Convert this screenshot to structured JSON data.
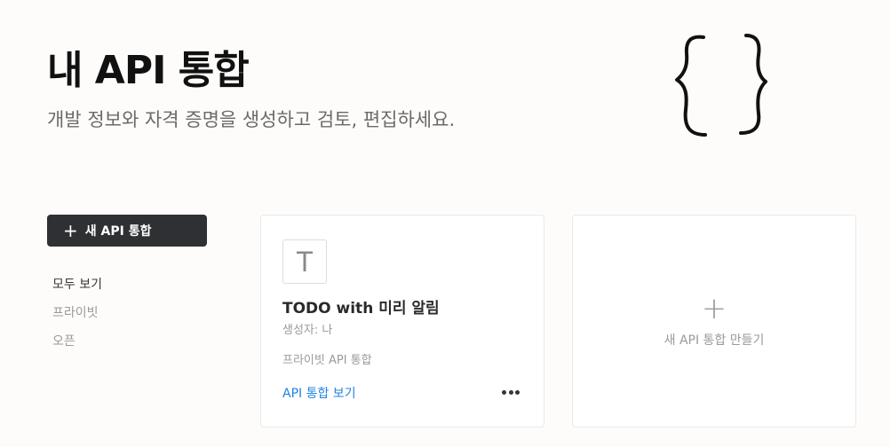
{
  "header": {
    "title": "내 API 통합",
    "subtitle": "개발 정보와 자격 증명을 생성하고 검토, 편집하세요.",
    "illustration_icon": "curly-braces-icon"
  },
  "sidebar": {
    "new_button": {
      "icon": "plus-icon",
      "label": "새 API 통합"
    },
    "filters": [
      {
        "label": "모두 보기",
        "active": true
      },
      {
        "label": "프라이빗",
        "active": false
      },
      {
        "label": "오픈",
        "active": false
      }
    ]
  },
  "integrations": [
    {
      "avatar_letter": "T",
      "name": "TODO with 미리 알림",
      "creator": "생성자: 나",
      "type": "프라이빗 API 통합",
      "view_label": "API 통합 보기",
      "more_icon": "more-horizontal-icon"
    }
  ],
  "create_card": {
    "icon": "plus-icon",
    "label": "새 API 통합 만들기"
  },
  "colors": {
    "background": "#fdfcfa",
    "button_dark": "#2f3033",
    "link_blue": "#2383e2",
    "muted_text": "#9b9a97"
  }
}
